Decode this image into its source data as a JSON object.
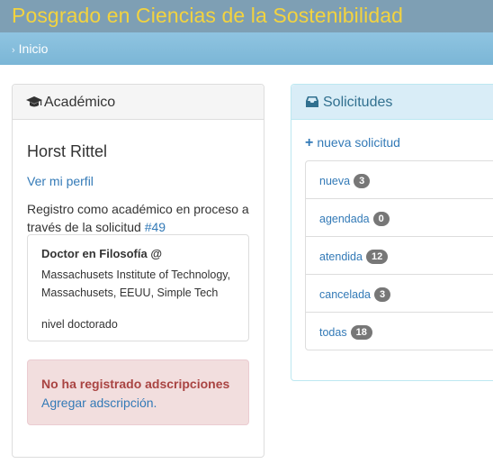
{
  "header": {
    "title": "Posgrado en Ciencias de la Sostenibilidad"
  },
  "breadcrumb": {
    "separator": "›",
    "home": "Inicio"
  },
  "academico": {
    "title": "Académico",
    "icon": "graduation-cap-icon",
    "name": "Horst Rittel",
    "profile_link": "Ver mi perfil",
    "registration_text": "Registro como académico en proceso a través de la solicitud",
    "request_link": "#49",
    "degree": {
      "title": "Doctor en Filosofía @",
      "institution": "Massachusets Institute of Technology, Massachusets, EEUU, Simple Tech",
      "level": "nivel doctorado"
    },
    "alert": {
      "title": "No ha registrado adscripciones",
      "link": "Agregar adscripción."
    }
  },
  "solicitudes": {
    "title": "Solicitudes",
    "icon": "inbox-icon",
    "new_request": "nueva solicitud",
    "items": [
      {
        "label": "nueva",
        "count": "3"
      },
      {
        "label": "agendada",
        "count": "0"
      },
      {
        "label": "atendida",
        "count": "12"
      },
      {
        "label": "cancelada",
        "count": "3"
      },
      {
        "label": "todas",
        "count": "18"
      }
    ]
  },
  "colors": {
    "title_yellow": "#f3d33f",
    "topbar": "#7e9fb4",
    "link": "#337ab7",
    "alert_text": "#a94442",
    "badge": "#777777"
  }
}
